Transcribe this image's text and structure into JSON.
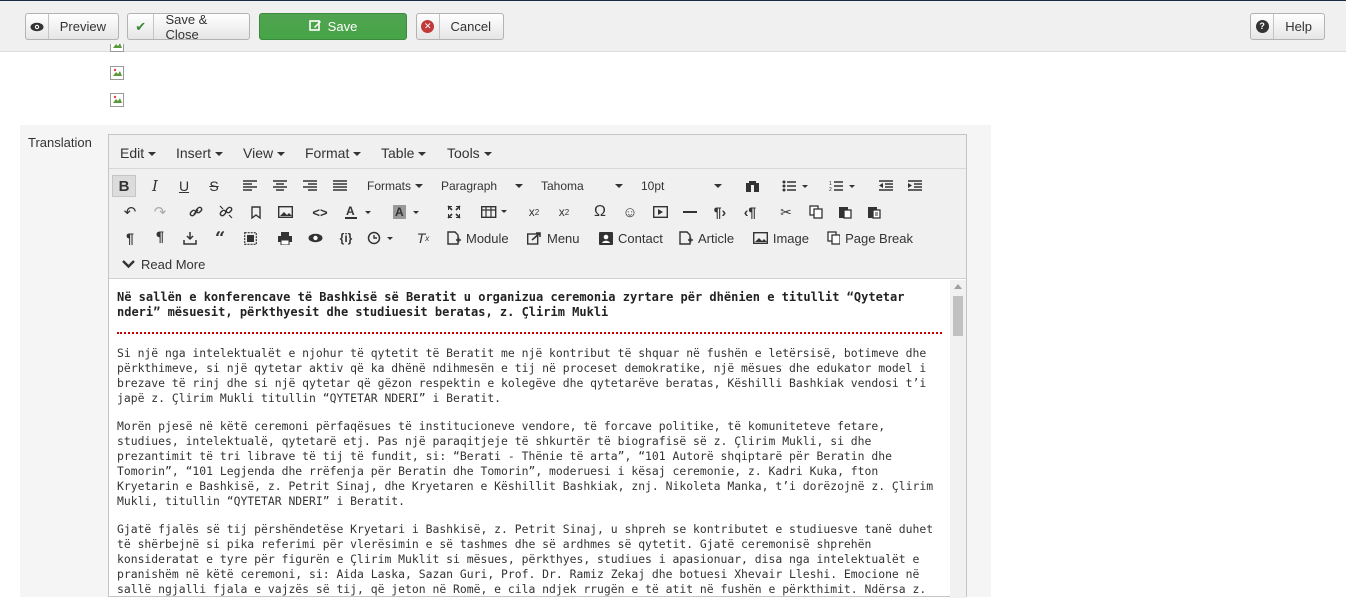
{
  "toolbar": {
    "preview": "Preview",
    "save_close": "Save & Close",
    "save": "Save",
    "cancel": "Cancel",
    "help": "Help"
  },
  "translation_label": "Translation",
  "menu": [
    "Edit",
    "Insert",
    "View",
    "Format",
    "Table",
    "Tools"
  ],
  "format_bar": {
    "formats": "Formats",
    "block": "Paragraph",
    "font": "Tahoma",
    "size": "10pt"
  },
  "buttons": {
    "module": "Module",
    "menu": "Menu",
    "contact": "Contact",
    "article": "Article",
    "image": "Image",
    "page_break": "Page Break",
    "read_more": "Read More"
  },
  "content": {
    "heading": "Në sallën e konferencave të Bashkisë së Beratit u organizua ceremonia zyrtare për dhënien e titullit “Qytetar nderi” mësuesit, përkthyesit dhe studiuesit beratas, z. Çlirim Mukli",
    "p1": "Si një nga intelektualët e njohur të qytetit të Beratit me një kontribut të shquar në fushën e letërsisë, botimeve dhe përkthimeve, si një qytetar aktiv që ka dhënë ndihmesën e tij në proceset demokratike, një mësues dhe edukator model i brezave të rinj dhe si një qytetar që gëzon respektin e kolegëve dhe qytetarëve beratas, Këshilli Bashkiak vendosi t’i japë z. Çlirim Mukli titullin “QYTETAR NDERI” i Beratit.",
    "p2": "Morën pjesë në këtë ceremoni përfaqësues të institucioneve vendore, të forcave politike, të komuniteteve fetare, studiues, intelektualë, qytetarë etj. Pas një paraqitjeje të shkurtër të biografisë së z. Çlirim Mukli, si dhe prezantimit të tri librave të tij të fundit, si: “Berati - Thënie të arta”, “101 Autorë shqiptarë për Beratin dhe Tomorin”, “101 Legjenda dhe rrëfenja për Beratin dhe Tomorin”, moderuesi i kësaj ceremonie, z. Kadri Kuka, fton Kryetarin e Bashkisë, z. Petrit Sinaj, dhe Kryetaren e Këshillit Bashkiak, znj. Nikoleta Manka, t’i dorëzojnë z. Çlirim Mukli, titullin “QYTETAR NDERI” i Beratit.",
    "p3": "Gjatë fjalës së tij përshëndetëse Kryetari i Bashkisë, z. Petrit Sinaj, u shpreh se kontributet e studiuesve tanë duhet të shërbejnë si pika referimi për vlerësimin e së tashmes dhe së ardhmes së qytetit. Gjatë ceremonisë shprehën konsideratat e tyre për figurën e Çlirim Muklit si mësues, përkthyes, studiues i apasionuar, disa nga intelektualët e pranishëm në këtë ceremoni, si: Aida Laska, Sazan Guri, Prof. Dr. Ramiz Zekaj dhe botuesi Xhevair Lleshi. Emocione në sallë ngjalli fjala e vajzës së tij, që jeton në Romë, e cila ndjek rrugën e të atit në fushën e përkthimit. Ndërsa z. Çlim Mukli në fjalën e vet, pasi falenderoi Bashkinë e Beratit për vlerësimin që i bëhet, shprehu mirënjohjen për të gjithë bashkëpunëtorët e tij ndër vite, që kanë bërë të mundur nxjerrjen në dritë të botimeve të tij."
  }
}
